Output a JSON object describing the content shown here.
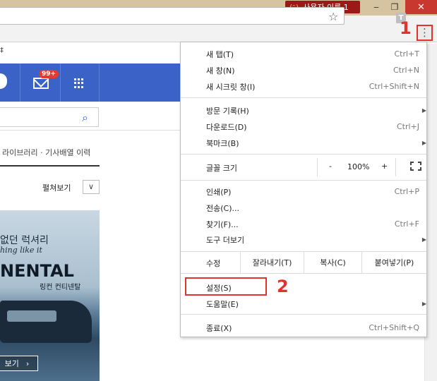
{
  "titlebar": {
    "profile_name": "사용자 이름 1",
    "profile_icon": "person-icon",
    "minimize": "‒",
    "maximize": "❐",
    "close": "✕"
  },
  "toolbar": {
    "star": "☆",
    "extension_label": "T",
    "menu_glyph": "⋮",
    "annotation_1": "1"
  },
  "page": {
    "bookmark_strip": "‡",
    "mail_badge": "99+",
    "library_text": "라이브러리 · 기사배열 이력",
    "expand_label": "펼쳐보기",
    "expand_btn": "∨",
    "ad": {
      "line1": "없던 럭셔리",
      "line2": "hing like it",
      "brand": "NENTAL",
      "subbrand": "링컨 컨티넨탈",
      "button": "보기",
      "button_arrow": "›"
    }
  },
  "menu": {
    "new_tab": {
      "label": "새 탭(T)",
      "shortcut": "Ctrl+T"
    },
    "new_window": {
      "label": "새 창(N)",
      "shortcut": "Ctrl+N"
    },
    "incognito": {
      "label": "새 시크릿 창(I)",
      "shortcut": "Ctrl+Shift+N"
    },
    "history": {
      "label": "방문 기록(H)"
    },
    "downloads": {
      "label": "다운로드(D)",
      "shortcut": "Ctrl+J"
    },
    "bookmarks": {
      "label": "북마크(B)"
    },
    "zoom": {
      "label": "글꼴 크기",
      "minus": "-",
      "value": "100%",
      "plus": "+"
    },
    "print": {
      "label": "인쇄(P)",
      "shortcut": "Ctrl+P"
    },
    "cast": {
      "label": "전송(C)..."
    },
    "find": {
      "label": "찾기(F)...",
      "shortcut": "Ctrl+F"
    },
    "more_tools": {
      "label": "도구 더보기"
    },
    "edit": {
      "label": "수정",
      "cut": "잘라내기(T)",
      "copy": "복사(C)",
      "paste": "붙여넣기(P)"
    },
    "settings": {
      "label": "설정(S)"
    },
    "help": {
      "label": "도움말(E)"
    },
    "exit": {
      "label": "종료(X)",
      "shortcut": "Ctrl+Shift+Q"
    },
    "submenu_arrow": "▶",
    "annotation_2": "2"
  },
  "colors": {
    "accent_annotation": "#e0332d",
    "blue_bar": "#3b63c7",
    "titlebar": "#d6c39f"
  }
}
